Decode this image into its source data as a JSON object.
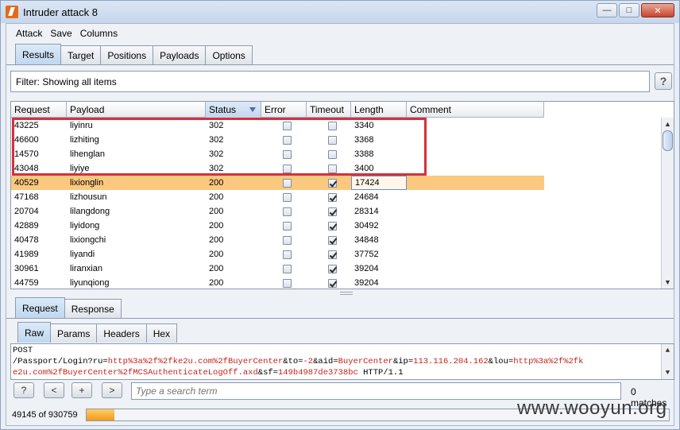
{
  "window": {
    "title": "Intruder attack 8"
  },
  "menu": [
    "Attack",
    "Save",
    "Columns"
  ],
  "main_tabs": [
    {
      "label": "Results",
      "active": true
    },
    {
      "label": "Target",
      "active": false
    },
    {
      "label": "Positions",
      "active": false
    },
    {
      "label": "Payloads",
      "active": false
    },
    {
      "label": "Options",
      "active": false
    }
  ],
  "filter": {
    "text": "Filter:  Showing all items"
  },
  "help_label": "?",
  "table": {
    "columns": [
      "Request",
      "Payload",
      "Status",
      "Error",
      "Timeout",
      "Length",
      "Comment"
    ],
    "sorted_column": "Status",
    "rows": [
      {
        "request": "43225",
        "payload": "liyinru",
        "status": "302",
        "error": false,
        "timeout": false,
        "length": "3340",
        "comment": ""
      },
      {
        "request": "46600",
        "payload": "lizhiting",
        "status": "302",
        "error": false,
        "timeout": false,
        "length": "3368",
        "comment": ""
      },
      {
        "request": "14570",
        "payload": "lihenglan",
        "status": "302",
        "error": false,
        "timeout": false,
        "length": "3388",
        "comment": ""
      },
      {
        "request": "43048",
        "payload": "liyiye",
        "status": "302",
        "error": false,
        "timeout": false,
        "length": "3400",
        "comment": ""
      },
      {
        "request": "40529",
        "payload": "lixionglin",
        "status": "200",
        "error": false,
        "timeout": true,
        "length": "17424",
        "comment": "",
        "selected": true
      },
      {
        "request": "47168",
        "payload": "lizhousun",
        "status": "200",
        "error": false,
        "timeout": true,
        "length": "24684",
        "comment": ""
      },
      {
        "request": "20704",
        "payload": "lilangdong",
        "status": "200",
        "error": false,
        "timeout": true,
        "length": "28314",
        "comment": ""
      },
      {
        "request": "42889",
        "payload": "liyidong",
        "status": "200",
        "error": false,
        "timeout": true,
        "length": "30492",
        "comment": ""
      },
      {
        "request": "40478",
        "payload": "lixiongchi",
        "status": "200",
        "error": false,
        "timeout": true,
        "length": "34848",
        "comment": ""
      },
      {
        "request": "41989",
        "payload": "liyandi",
        "status": "200",
        "error": false,
        "timeout": true,
        "length": "37752",
        "comment": ""
      },
      {
        "request": "30961",
        "payload": "liranxian",
        "status": "200",
        "error": false,
        "timeout": true,
        "length": "39204",
        "comment": ""
      },
      {
        "request": "44759",
        "payload": "liyunqiong",
        "status": "200",
        "error": false,
        "timeout": true,
        "length": "39204",
        "comment": ""
      }
    ]
  },
  "detail_tabs": [
    {
      "label": "Request",
      "active": true
    },
    {
      "label": "Response",
      "active": false
    }
  ],
  "view_tabs": [
    {
      "label": "Raw",
      "active": true
    },
    {
      "label": "Params",
      "active": false
    },
    {
      "label": "Headers",
      "active": false
    },
    {
      "label": "Hex",
      "active": false
    }
  ],
  "raw": {
    "line1": "POST",
    "line2_pre": "/Passport/Login?ru=",
    "line2_hl1": "http%3a%2f%2fke2u.com%2fBuyerCenter",
    "line2_mid1": "&to=",
    "line2_hl2": "-2",
    "line2_mid2": "&aid=",
    "line2_hl3": "BuyerCenter",
    "line2_mid3": "&ip=",
    "line2_hl4": "113.116.204.162",
    "line2_mid4": "&lou=",
    "line2_hl5": "http%3a%2f%2fk",
    "line3_hl1": "e2u.com%2fBuyerCenter%2fMCSAuthenticateLogOff.axd",
    "line3_mid1": "&sf=",
    "line3_hl2": "149b4987de3738bc",
    "line3_post": " HTTP/1.1"
  },
  "search": {
    "help": "?",
    "prev": "<",
    "add": "+",
    "next": ">",
    "placeholder": "Type a search term",
    "matches": "0 matches"
  },
  "status": {
    "count": "49145 of 930759",
    "progress": 0.048
  },
  "watermark": "www.wooyun.org",
  "colors": {
    "selected_row": "#fbc880",
    "highlight_box": "#d6303a",
    "progress": "#f29a1c",
    "raw_highlight": "#c4231c"
  }
}
